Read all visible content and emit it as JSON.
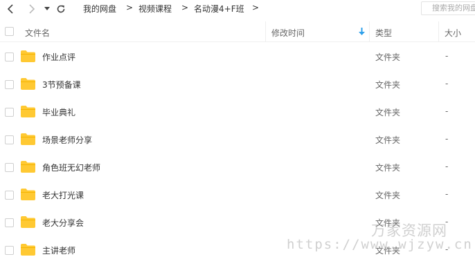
{
  "toolbar": {
    "back_icon": "chevron-left-icon",
    "forward_icon": "chevron-right-icon",
    "dropdown_icon": "caret-down-icon",
    "refresh_icon": "refresh-icon",
    "breadcrumb": [
      "我的网盘",
      "视频课程",
      "名动漫4+F班"
    ],
    "separator": ">",
    "search_placeholder": "搜索我的网盘文件"
  },
  "columns": {
    "name": "文件名",
    "modified": "修改时间",
    "type": "类型",
    "size": "大小",
    "sort_icon": "sort-down-arrow-icon"
  },
  "rows": [
    {
      "name": "作业点评",
      "type": "文件夹",
      "size": "-",
      "icon": "folder-icon"
    },
    {
      "name": "3节预备课",
      "type": "文件夹",
      "size": "-",
      "icon": "folder-icon"
    },
    {
      "name": "毕业典礼",
      "type": "文件夹",
      "size": "-",
      "icon": "folder-icon"
    },
    {
      "name": "场景老师分享",
      "type": "文件夹",
      "size": "-",
      "icon": "folder-icon"
    },
    {
      "name": "角色班无幻老师",
      "type": "文件夹",
      "size": "-",
      "icon": "folder-icon"
    },
    {
      "name": "老大打光课",
      "type": "文件夹",
      "size": "-",
      "icon": "folder-icon"
    },
    {
      "name": "老大分享会",
      "type": "文件夹",
      "size": "-",
      "icon": "folder-icon"
    },
    {
      "name": "主讲老师",
      "type": "文件夹",
      "size": "-",
      "icon": "folder-icon"
    }
  ],
  "watermark": {
    "logo": "万家资源网",
    "url": "https://www.wjzyw.cn"
  },
  "colors": {
    "folder": "#ffc933",
    "sort_arrow": "#2fa0ea",
    "text": "#333333",
    "muted": "#666666"
  }
}
